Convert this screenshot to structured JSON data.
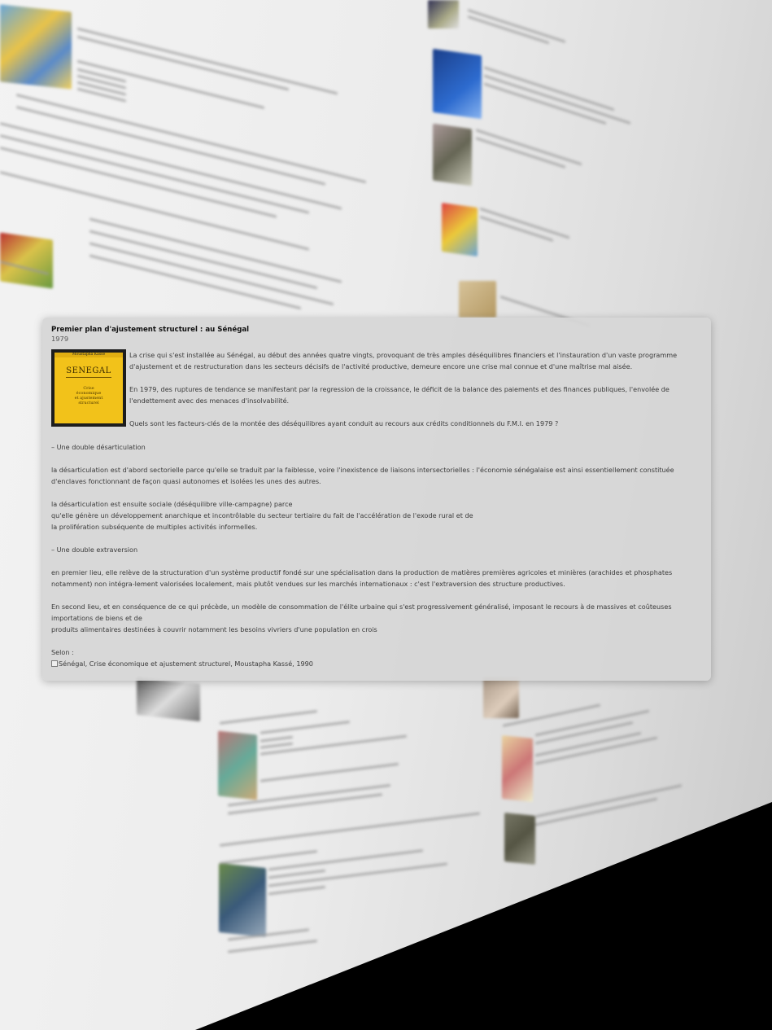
{
  "card": {
    "title": "Premier plan d'ajustement structurel : au Sénégal",
    "year": "1979",
    "cover": {
      "author": "Moustapha Kassé",
      "title": "SENEGAL",
      "subtitle_1": "Crise",
      "subtitle_2": "économique",
      "subtitle_3": "et ajustement",
      "subtitle_4": "structurel"
    },
    "intro_p1": "La crise qui s'est installée au Sénégal, au début des années quatre vingts, provoquant de très amples déséquilibres financiers et l'instauration d'un vaste programme d'ajustement et de restructuration dans les secteurs décisifs de l'activité productive, demeure encore une crise mal connue et d'une maîtrise mal aisée.",
    "intro_p2": "En 1979, des ruptures de tendance se manifestant par la regression de la croissance, le déficit de la balance des paiements et des finances publiques, l'envolée de l'endettement avec des menaces d'insolvabilité.",
    "question": "Quels sont les facteurs-clés de la montée des déséquilibres ayant conduit au recours aux crédits conditionnels du F.M.I. en 1979 ?",
    "heading_1": "– Une double désarticulation",
    "para_1": "la désarticulation est d'abord sectorielle parce qu'elle se traduit par la faiblesse, voire l'inexistence de liaisons intersectorielles : l'économie sénégalaise est ainsi essentiellement constituée d'enclaves fonctionnant de façon quasi autonomes et isolées les unes des autres.",
    "para_2_line1": "la désarticulation est ensuite sociale (déséquilibre ville-campagne) parce",
    "para_2_line2": "qu'elle génère un développement anarchique et incontrôlable du secteur tertiaire du fait de l'accélération de l'exode rural et de",
    "para_2_line3": "la prolifération subséquente de multiples activités informelles.",
    "heading_2": "– Une double extraversion",
    "para_3": "en premier lieu, elle relève de la structuration d'un système productif fondé sur une spécialisation dans la production de matières premières agricoles et minières (arachides et phosphates notamment) non intégra-lement valorisées localement, mais plutôt vendues sur les marchés internationaux : c'est l'extraversion des structure productives.",
    "para_4_line1": "En second lieu, et en conséquence de ce qui précède, un modèle de consommation de l'élite urbaine qui s'est progressivement généralisé, imposant le recours à de massives et coûteuses importations de biens et de",
    "para_4_line2": "produits alimentaires destinées à couvrir notamment les besoins vivriers d'une population en crois",
    "source_label": "Selon :",
    "source_ref": "Sénégal, Crise économique et ajustement structurel, Moustapha Kassé, 1990"
  },
  "colors": {
    "card_bg": "#d6d6d6",
    "cover_yellow": "#f2c21a",
    "text": "#3a3a3a"
  }
}
